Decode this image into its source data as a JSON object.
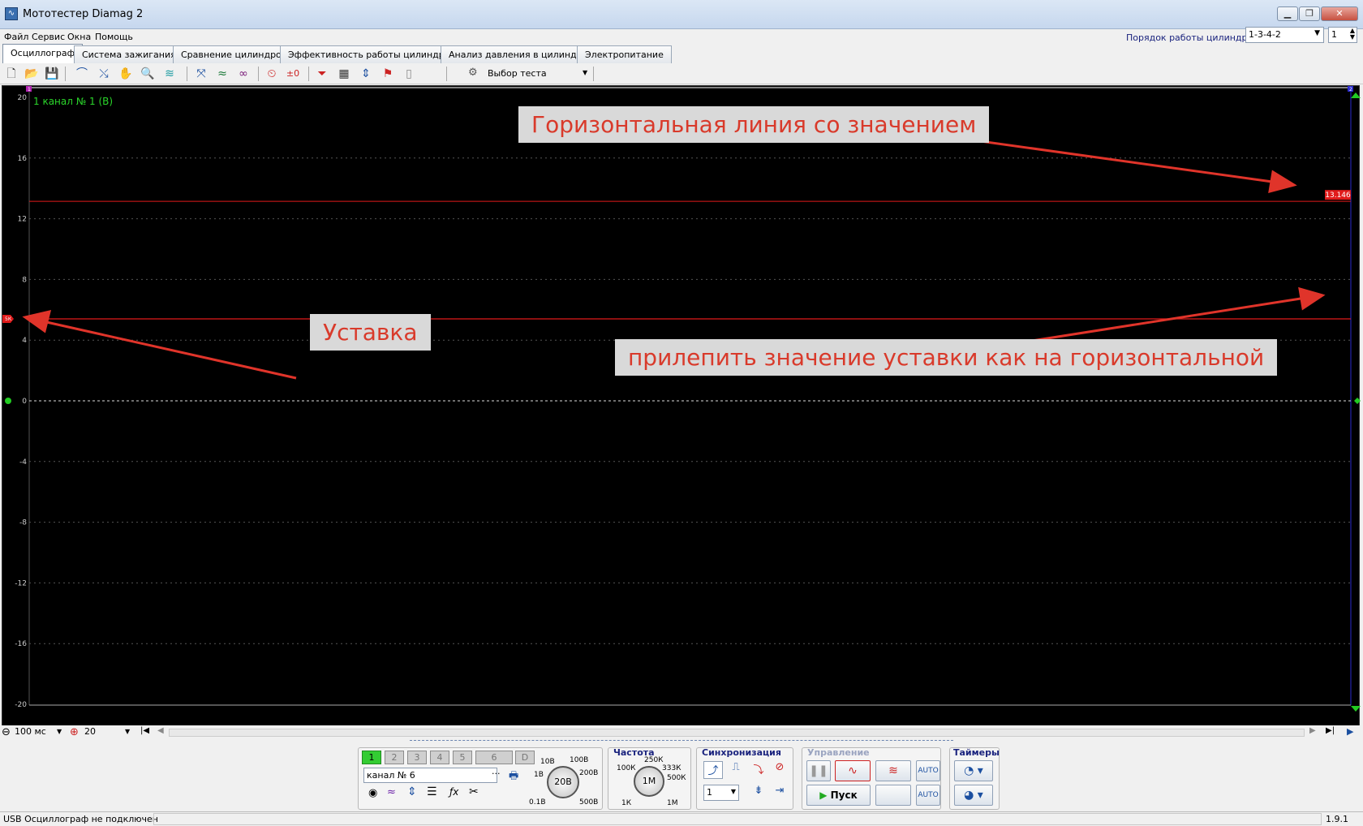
{
  "window": {
    "title": "Мототестер Diamag 2",
    "controls": {
      "minimize": "▁",
      "restore": "❐",
      "close": "✕"
    }
  },
  "menu": [
    "Файл",
    "Сервис",
    "Окна",
    "Помощь"
  ],
  "cylinder_order": {
    "label": "Порядок работы цилиндров",
    "value": "1-3-4-2",
    "count": "1"
  },
  "tabs": [
    "Осциллограф",
    "Система зажигания",
    "Сравнение цилиндров",
    "Эффективность работы цилиндров",
    "Анализ давления в цилиндре",
    "Электропитание"
  ],
  "active_tab": 0,
  "toolbar": {
    "test_select": "Выбор теста",
    "auto_label": "AUTO"
  },
  "scope": {
    "channel_label": "1  канал № 1 (В)",
    "y_ticks": [
      "20",
      "16",
      "12",
      "8",
      "4",
      "0",
      "-4",
      "-8",
      "-12",
      "-16",
      "-20"
    ],
    "horizontal_line_value": "13.146",
    "markers": {
      "top_left": "1",
      "top_right": "2",
      "setpoint": "5К"
    },
    "colors": {
      "background": "#000000",
      "grid": "#555555",
      "line": "#e11b1b",
      "channel_text": "#2bd62b"
    }
  },
  "annotations": {
    "horizontal": "Горизонтальная линия со значением",
    "setpoint": "Уставка",
    "stick": "прилепить значение уставки как на горизонтальной"
  },
  "timebase": {
    "time": "100 мс",
    "zoom": "20"
  },
  "channels": {
    "buttons": [
      "1",
      "2",
      "3",
      "4",
      "5",
      "6",
      "D"
    ],
    "name": "канал № 6"
  },
  "voltage_knob": {
    "value": "20В",
    "labels": [
      "10В",
      "100В",
      "1В",
      "200В",
      "0.1В",
      "500В"
    ]
  },
  "frequency": {
    "title": "Частота",
    "value": "1М",
    "labels": [
      "250К",
      "100К",
      "333К",
      "500К",
      "1К",
      "1М"
    ]
  },
  "sync": {
    "title": "Синхронизация",
    "value": "1"
  },
  "control": {
    "title": "Управление",
    "start": "Пуск"
  },
  "timers": {
    "title": "Таймеры"
  },
  "status": {
    "left": "USB Осциллограф не подключен",
    "version": "1.9.1"
  }
}
